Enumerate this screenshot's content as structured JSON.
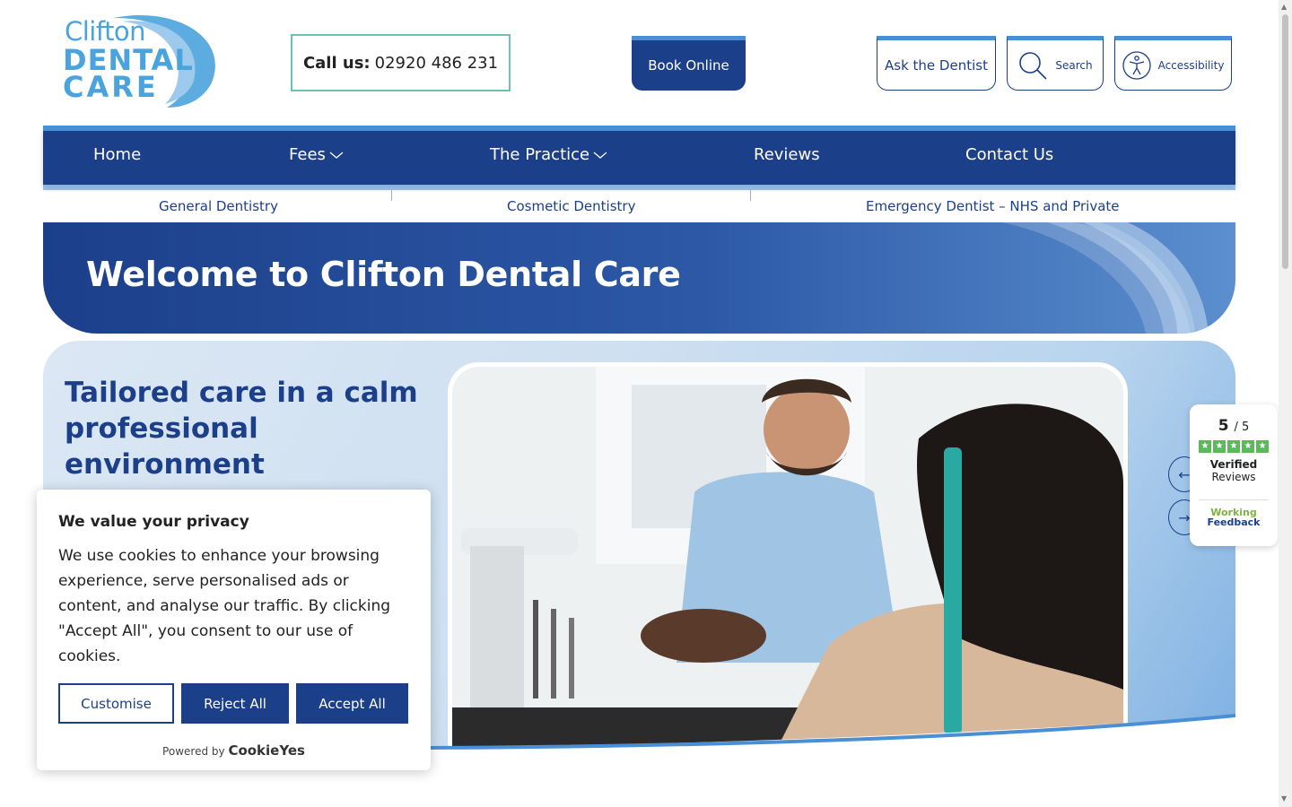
{
  "brand": {
    "logo_line1": "Clifton",
    "logo_line2": "DENTAL",
    "logo_line3": "CARE",
    "primary_color": "#1c3f8a",
    "accent_color": "#4a8fd6"
  },
  "header": {
    "call_label": "Call us:",
    "call_number": "02920 486 231",
    "book_label": "Book Online",
    "ask_label": "Ask the Dentist",
    "search_label": "Search",
    "accessibility_label": "Accessibility"
  },
  "nav": {
    "items": [
      {
        "label": "Home"
      },
      {
        "label": "Fees"
      },
      {
        "label": "The Practice"
      },
      {
        "label": "Reviews"
      },
      {
        "label": "Contact Us"
      }
    ]
  },
  "subnav": {
    "items": [
      {
        "label": "General Dentistry"
      },
      {
        "label": "Cosmetic Dentistry"
      },
      {
        "label": "Emergency Dentist – NHS and Private"
      }
    ]
  },
  "banner": {
    "title": "Welcome to Clifton Dental Care"
  },
  "hero": {
    "heading": "Tailored care in a calm professional environment"
  },
  "reviews_widget": {
    "score": "5",
    "score_max": "/ 5",
    "verified": "Verified",
    "reviews": "Reviews",
    "provider_line1": "Working",
    "provider_line2": "Feedback"
  },
  "cookie": {
    "title": "We value your privacy",
    "body": "We use cookies to enhance your browsing experience, serve personalised ads or content, and analyse our traffic. By clicking \"Accept All\", you consent to our use of cookies.",
    "customise": "Customise",
    "reject": "Reject All",
    "accept": "Accept All",
    "powered_by": "Powered by",
    "powered_brand": "CookieYes"
  }
}
